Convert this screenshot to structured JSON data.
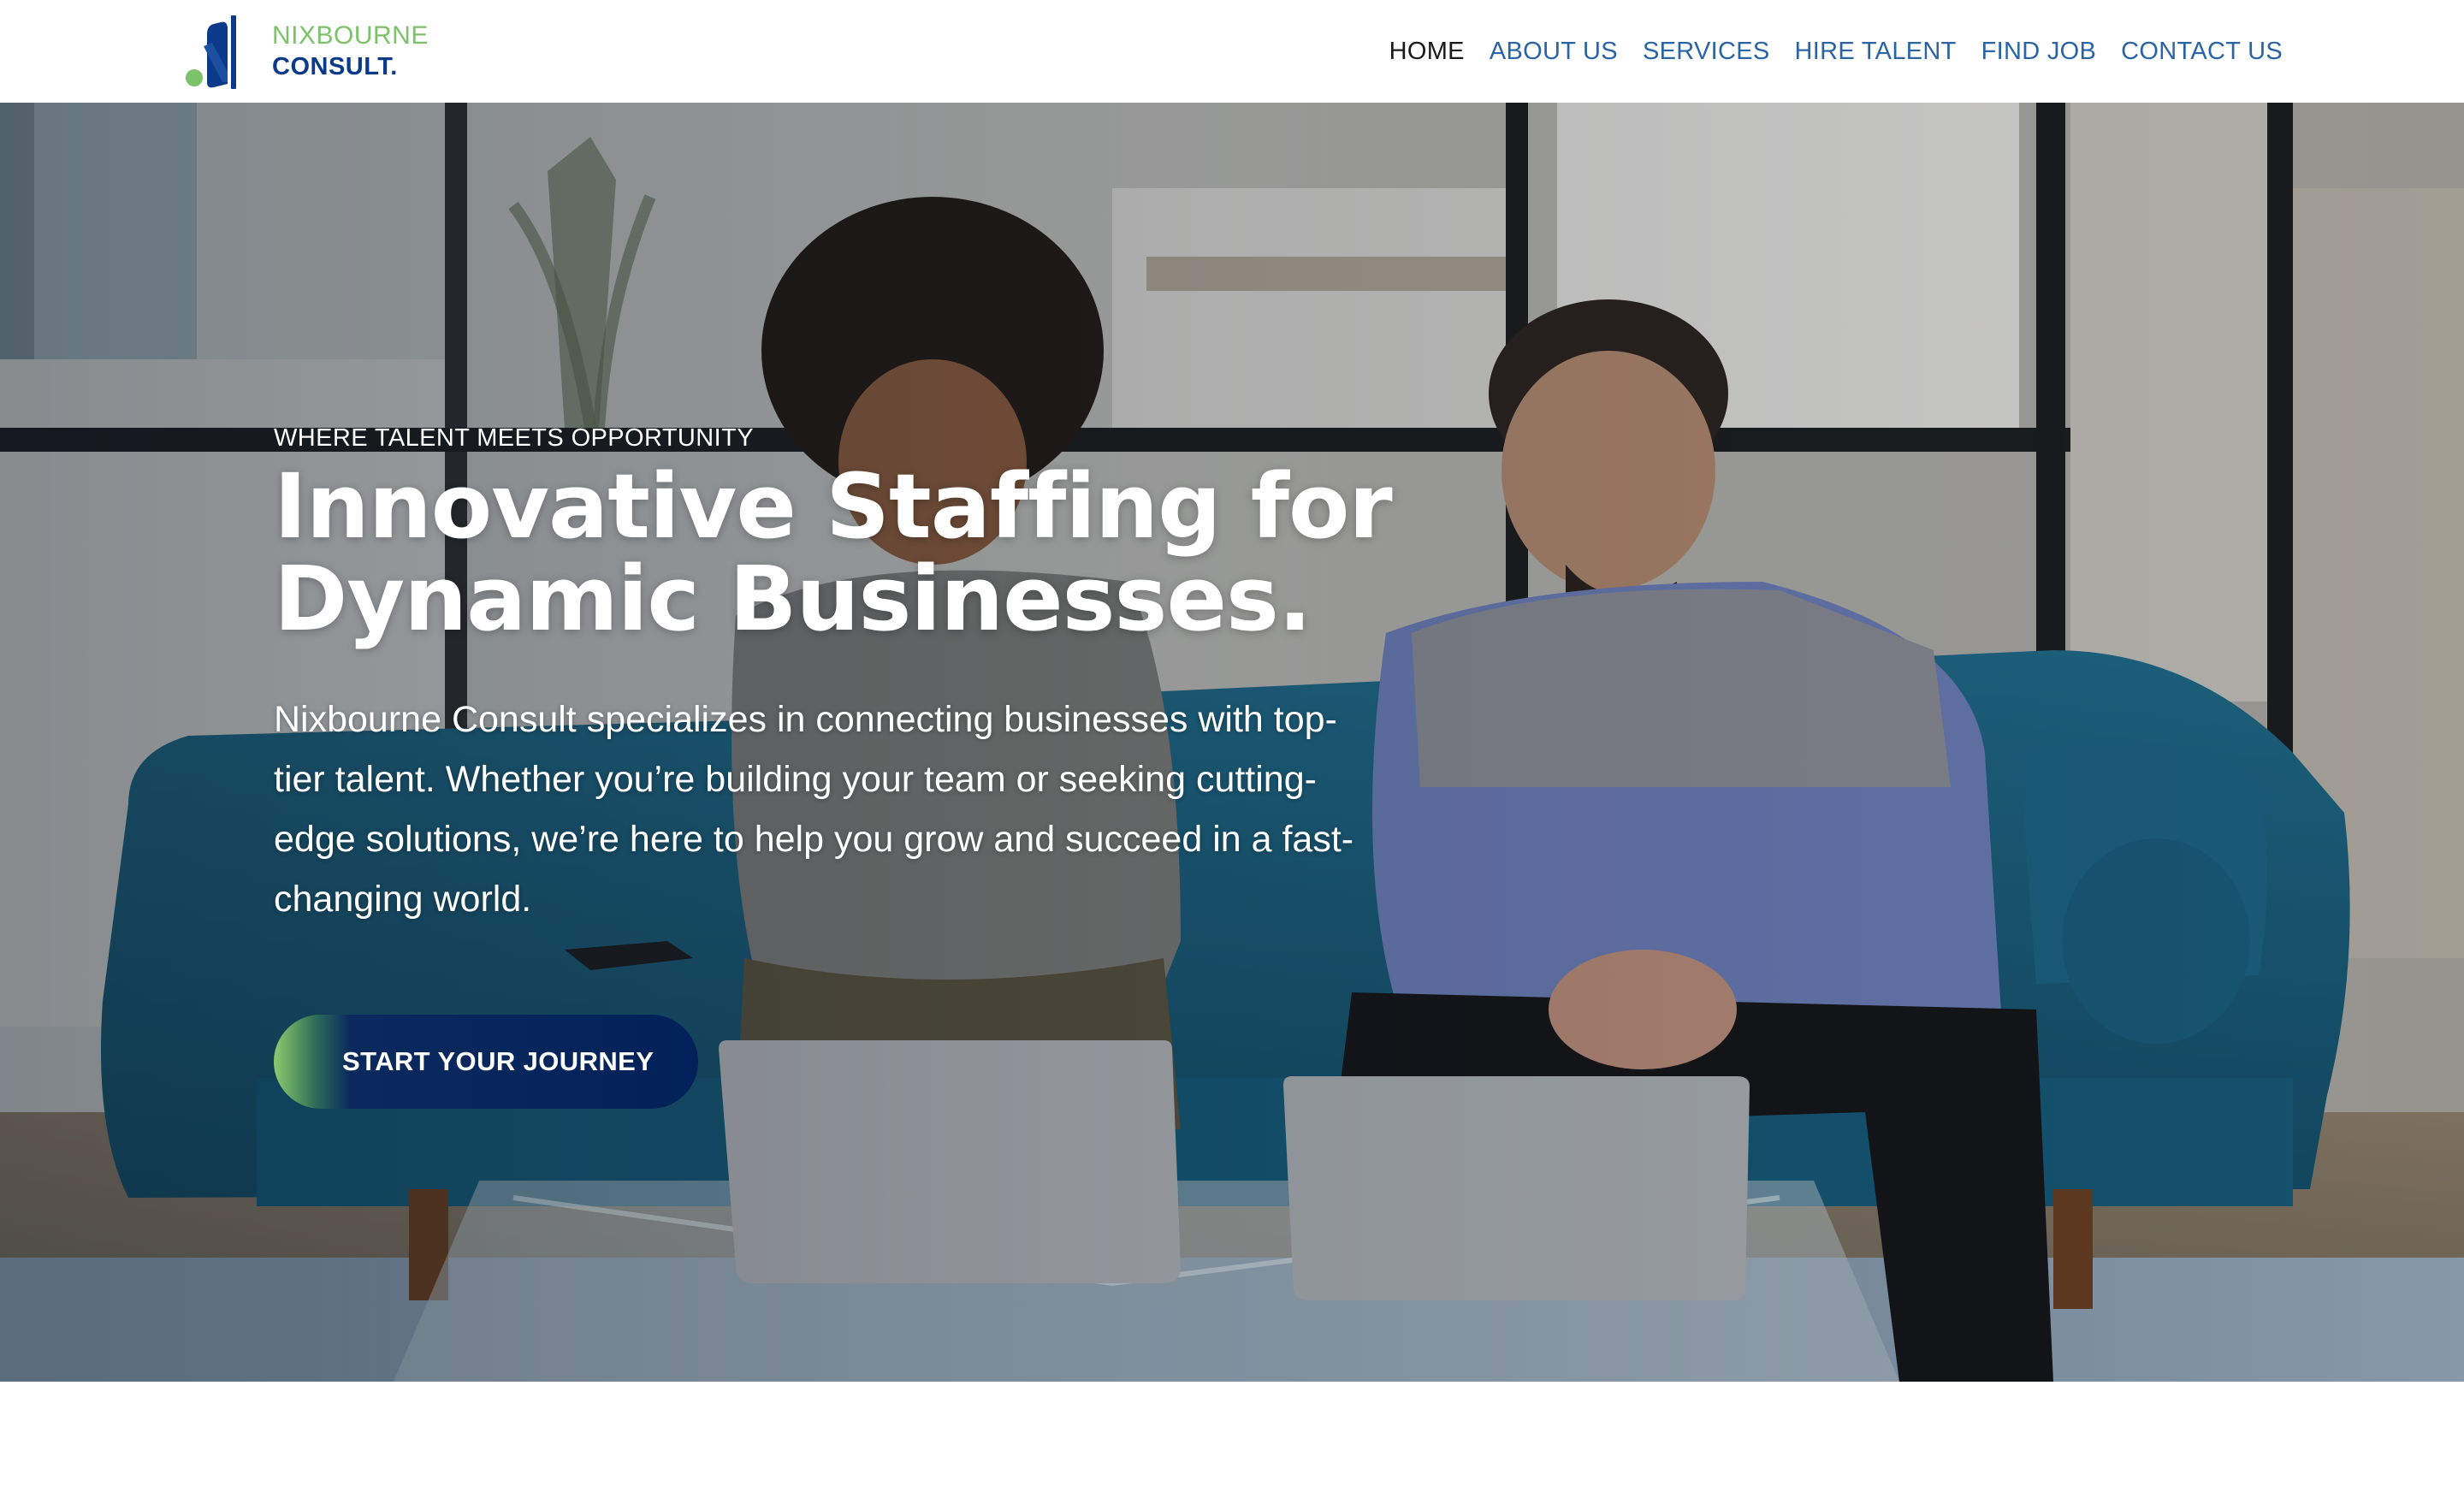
{
  "brand": {
    "line1": "NIXBOURNE",
    "line2": "CONSULT.",
    "colors": {
      "green": "#7cc26a",
      "navy": "#0b3a8a"
    }
  },
  "nav": {
    "items": [
      {
        "label": "HOME",
        "active": true
      },
      {
        "label": "ABOUT US",
        "active": false
      },
      {
        "label": "SERVICES",
        "active": false
      },
      {
        "label": "HIRE TALENT",
        "active": false
      },
      {
        "label": "FIND JOB",
        "active": false
      },
      {
        "label": "CONTACT US",
        "active": false
      }
    ]
  },
  "hero": {
    "eyebrow": "WHERE TALENT MEETS OPPORTUNITY",
    "headline_line1": "Innovative Staffing for",
    "headline_line2": "Dynamic Businesses.",
    "description": "Nixbourne Consult specializes in connecting businesses with top-tier talent. Whether you’re building your team or seeking cutting-edge solutions, we’re here to help you grow and succeed in a fast-changing world.",
    "cta_label": "START YOUR JOURNEY"
  },
  "theme": {
    "nav_link": "#2b64a6",
    "nav_active": "#1a1a1a",
    "cta_navy": "#02215a",
    "cta_green": "#8ccc6e"
  }
}
